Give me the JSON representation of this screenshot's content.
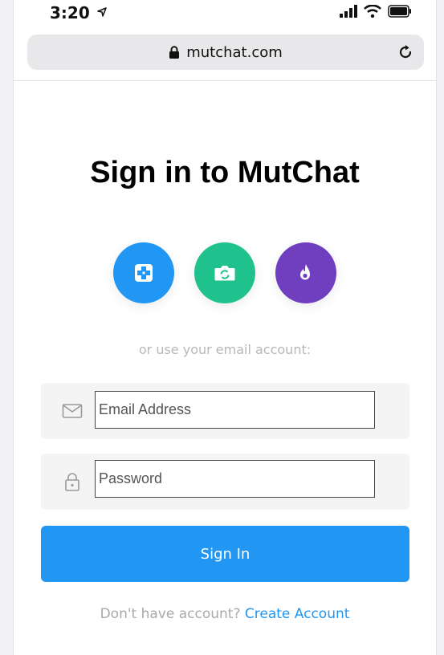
{
  "status_bar": {
    "time": "3:20"
  },
  "browser": {
    "url": "mutchat.com"
  },
  "page": {
    "title": "Sign in to MutChat",
    "alt_login_text": "or use your email account:",
    "email": {
      "placeholder": "Email Address",
      "value": ""
    },
    "password": {
      "placeholder": "Password",
      "value": ""
    },
    "signin_label": "Sign In",
    "no_account_text": "Don't have account?",
    "create_account_label": "Create Account"
  },
  "social_buttons": [
    {
      "icon": "plus-box-icon",
      "color": "#2196f3"
    },
    {
      "icon": "camera-icon",
      "color": "#1fc28d"
    },
    {
      "icon": "flame-icon",
      "color": "#6f3fc0"
    }
  ],
  "colors": {
    "accent": "#2196f3",
    "muted_text": "#b7b7b7"
  }
}
